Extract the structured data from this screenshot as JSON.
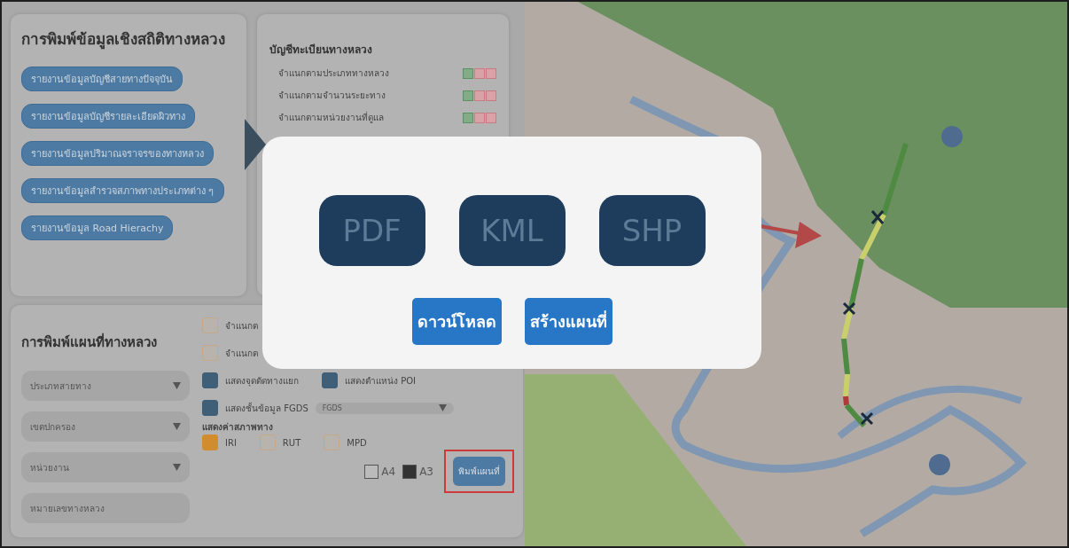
{
  "stats_panel": {
    "title": "การพิมพ์ข้อมูลเชิงสถิติทางหลวง",
    "reports": [
      {
        "label": "รายงานข้อมูลบัญชีสายทางปัจจุบัน"
      },
      {
        "label": "รายงานข้อมูลบัญชีรายละเอียดผิวทาง"
      },
      {
        "label": "รายงานข้อมูลปริมาณจราจรของทางหลวง"
      },
      {
        "label": "รายงานข้อมูลสำรวจสภาพทางประเภทต่าง ๆ"
      },
      {
        "label": "รายงานข้อมูล Road Hierachy"
      }
    ]
  },
  "registry_panel": {
    "title": "บัญชีทะเบียนทางหลวง",
    "rows": [
      {
        "label": "จำแนกตามประเภททางหลวง"
      },
      {
        "label": "จำแนกตามจำนวนระยะทาง"
      },
      {
        "label": "จำแนกตามหน่วยงานที่ดูแล"
      }
    ]
  },
  "map_print_panel": {
    "title": "การพิมพ์แผนที่ทางหลวง",
    "dropdowns": [
      {
        "value": "ประเภทสายทาง"
      },
      {
        "value": "เขตปกครอง"
      },
      {
        "value": "หน่วยงาน"
      }
    ],
    "highway_field": {
      "placeholder": "หมายเลขทางหลวง"
    },
    "options": [
      {
        "label": "จำแนกต",
        "checked": false
      },
      {
        "label": "จำแนกต",
        "checked": false
      },
      {
        "label": "แสดงจุดตัดทางแยก",
        "checked": true
      },
      {
        "label": "แสดงตำแหน่ง POI",
        "checked": true
      },
      {
        "label": "แสดงชั้นข้อมูล FGDS",
        "checked": true,
        "select": "FGDS"
      }
    ],
    "condition_label": "แสดงค่าสภาพทาง",
    "conditions": [
      {
        "label": "IRI",
        "checked": true
      },
      {
        "label": "RUT",
        "checked": false
      },
      {
        "label": "MPD",
        "checked": false
      }
    ],
    "paper_sizes": [
      {
        "label": "A4",
        "selected": false
      },
      {
        "label": "A3",
        "selected": true
      }
    ],
    "print_button": "พิมพ์แผนที่"
  },
  "export_dialog": {
    "formats": [
      {
        "label": "PDF"
      },
      {
        "label": "KML"
      },
      {
        "label": "SHP"
      }
    ],
    "buttons": [
      "ดาวน์โหลด",
      "สร้างแผนที่"
    ]
  }
}
